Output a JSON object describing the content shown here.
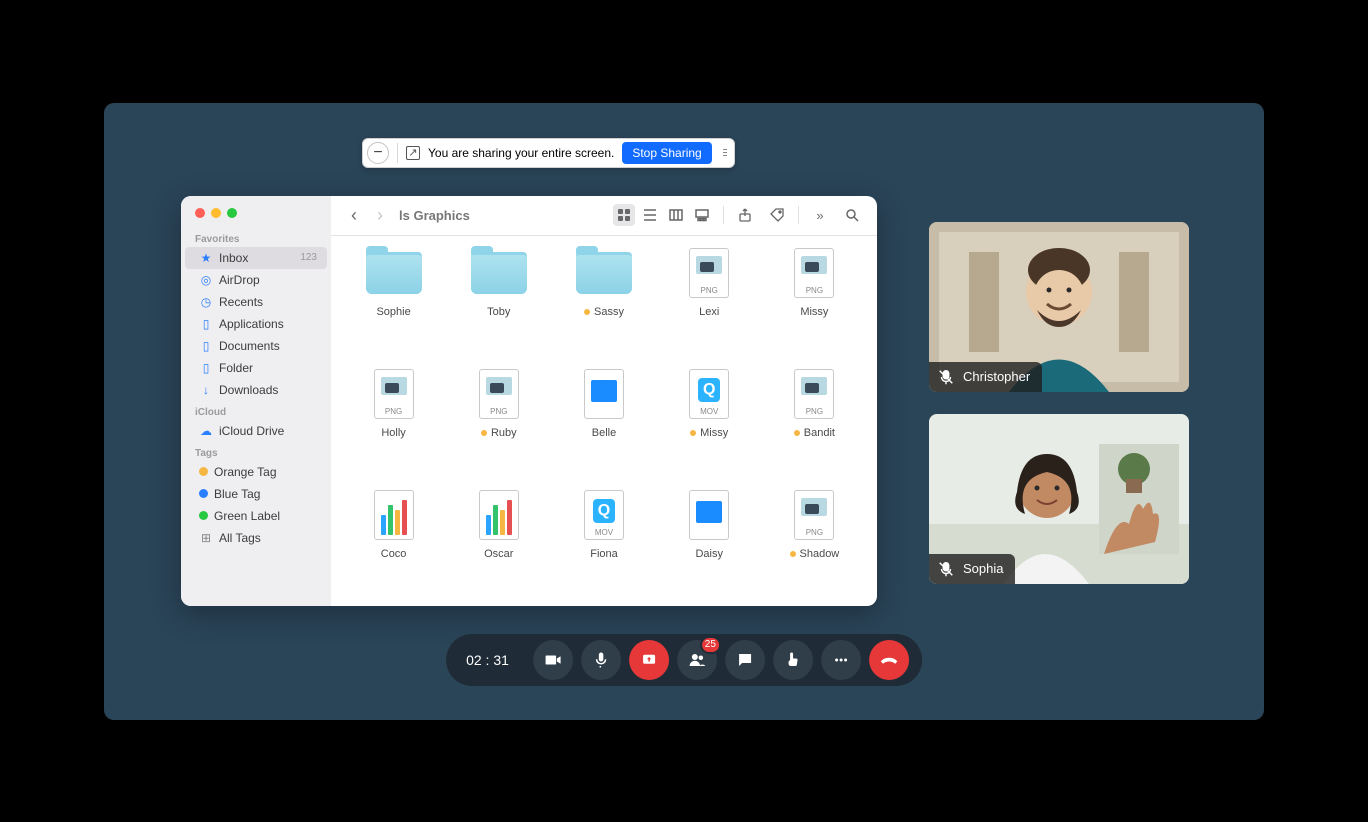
{
  "share_bar": {
    "message": "You are sharing your entire screen.",
    "stop": "Stop Sharing",
    "collapse": "−"
  },
  "finder": {
    "title": "ls Graphics",
    "sidebar": {
      "sections": {
        "favorites": "Favorites",
        "icloud": "iCloud",
        "tags": "Tags"
      },
      "favorites": [
        {
          "icon": "star",
          "label": "Inbox",
          "count": "123",
          "active": true
        },
        {
          "icon": "airdrop",
          "label": "AirDrop"
        },
        {
          "icon": "clock",
          "label": "Recents"
        },
        {
          "icon": "doc",
          "label": "Applications"
        },
        {
          "icon": "docs",
          "label": "Documents"
        },
        {
          "icon": "folder",
          "label": "Folder"
        },
        {
          "icon": "download",
          "label": "Downloads"
        }
      ],
      "icloud": [
        {
          "icon": "cloud",
          "label": "iCloud Drive"
        }
      ],
      "tags": [
        {
          "color": "#f6b642",
          "label": "Orange Tag"
        },
        {
          "color": "#2a7fff",
          "label": "Blue Tag"
        },
        {
          "color": "#28c840",
          "label": "Green Label"
        },
        {
          "color": "alltags",
          "label": "All Tags"
        }
      ]
    },
    "files": [
      {
        "name": "Sophie",
        "type": "folder",
        "tagged": false
      },
      {
        "name": "Toby",
        "type": "folder",
        "tagged": false
      },
      {
        "name": "Sassy",
        "type": "folder",
        "tagged": true
      },
      {
        "name": "Lexi",
        "type": "png",
        "tagged": false,
        "badge": "PNG"
      },
      {
        "name": "Missy",
        "type": "png",
        "tagged": false,
        "badge": "PNG"
      },
      {
        "name": "Holly",
        "type": "png",
        "tagged": false,
        "badge": "PNG"
      },
      {
        "name": "Ruby",
        "type": "png",
        "tagged": true,
        "badge": "PNG"
      },
      {
        "name": "Belle",
        "type": "keynote",
        "tagged": false
      },
      {
        "name": "Missy",
        "type": "mov",
        "tagged": true,
        "badge": "MOV"
      },
      {
        "name": "Bandit",
        "type": "png",
        "tagged": true,
        "badge": "PNG"
      },
      {
        "name": "Coco",
        "type": "chart",
        "tagged": false
      },
      {
        "name": "Oscar",
        "type": "chart",
        "tagged": false
      },
      {
        "name": "Fiona",
        "type": "mov",
        "tagged": false,
        "badge": "MOV"
      },
      {
        "name": "Daisy",
        "type": "keynote",
        "tagged": false
      },
      {
        "name": "Shadow",
        "type": "png",
        "tagged": true,
        "badge": "PNG"
      }
    ]
  },
  "participants": [
    {
      "name": "Christopher",
      "muted": true
    },
    {
      "name": "Sophia",
      "muted": true
    }
  ],
  "controls": {
    "timer": "02 : 31",
    "badge": "25"
  }
}
